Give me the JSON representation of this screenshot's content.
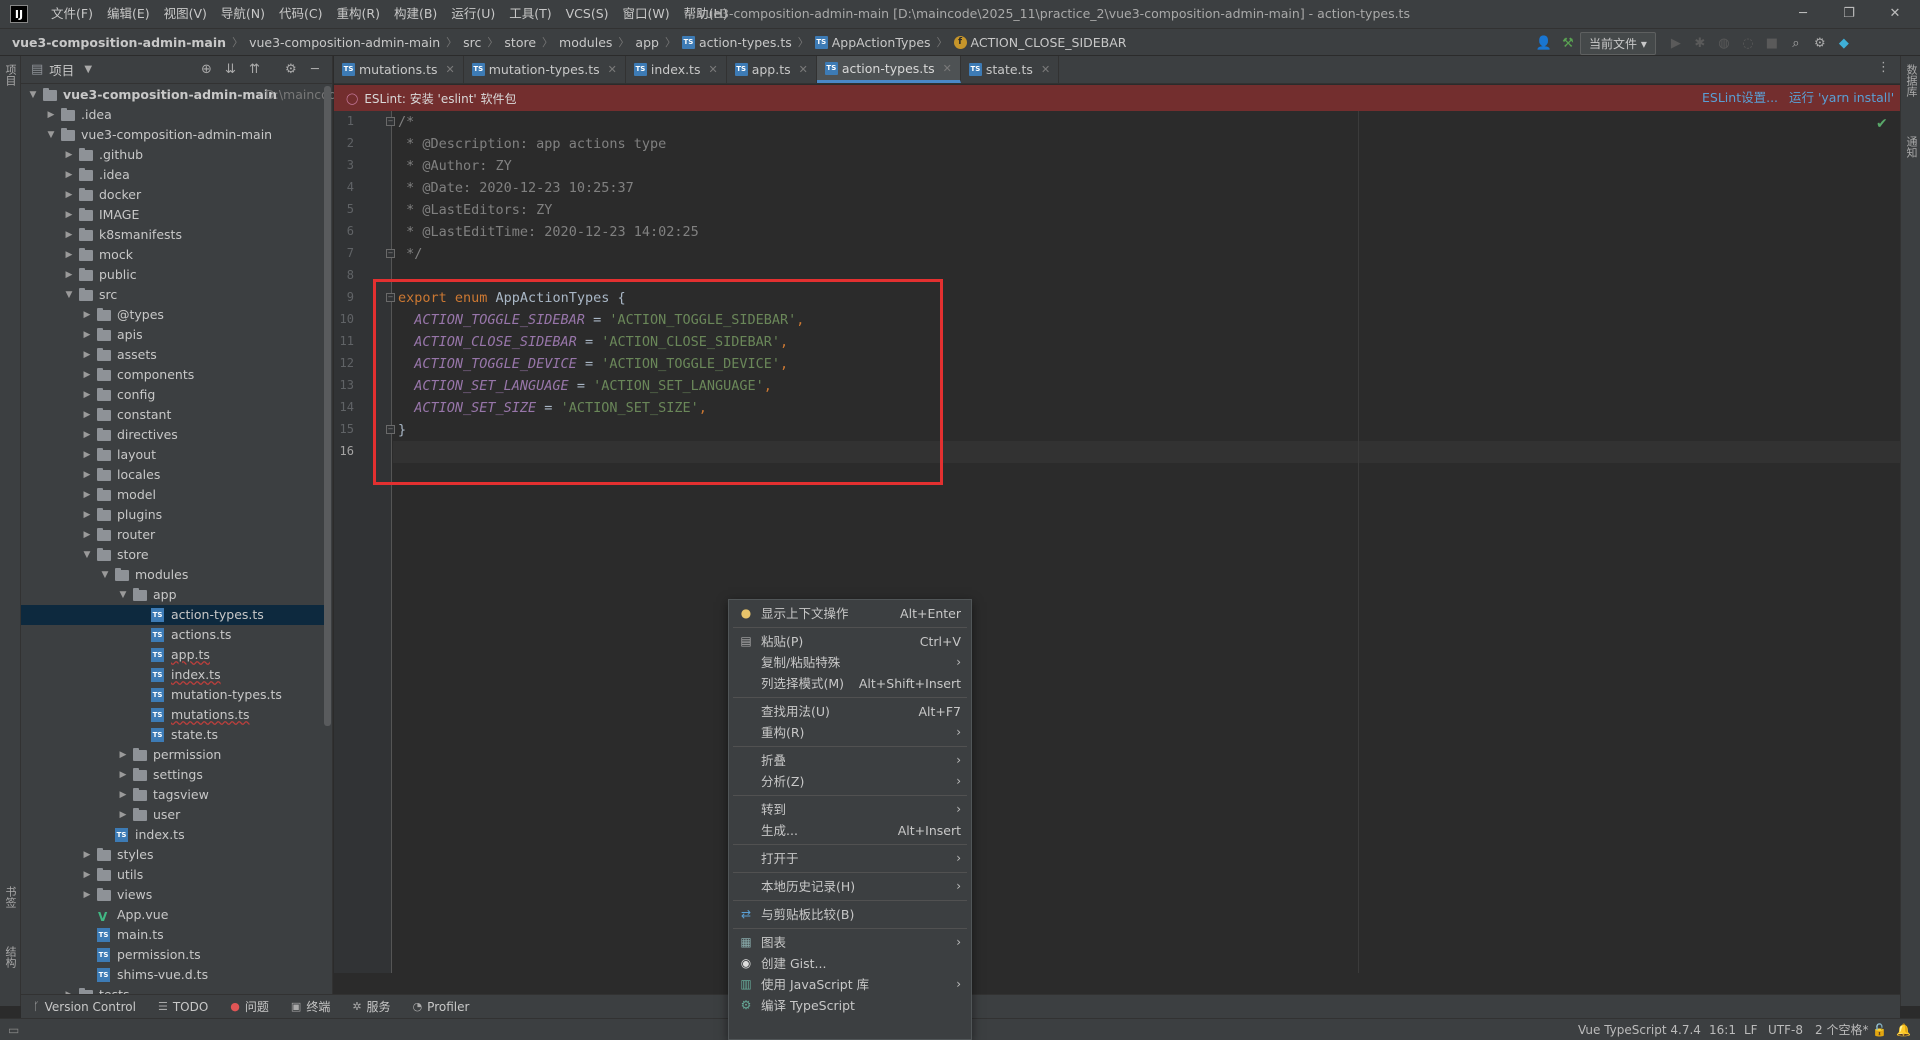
{
  "menubar": {
    "logo": "IJ",
    "items": [
      "文件(F)",
      "编辑(E)",
      "视图(V)",
      "导航(N)",
      "代码(C)",
      "重构(R)",
      "构建(B)",
      "运行(U)",
      "工具(T)",
      "VCS(S)",
      "窗口(W)",
      "帮助(H)"
    ],
    "title": "vue3-composition-admin-main [D:\\maincode\\2025_11\\practice_2\\vue3-composition-admin-main] - action-types.ts"
  },
  "breadcrumb": {
    "items": [
      "vue3-composition-admin-main",
      "vue3-composition-admin-main",
      "src",
      "store",
      "modules",
      "app",
      "action-types.ts",
      "AppActionTypes",
      "ACTION_CLOSE_SIDEBAR"
    ],
    "run_config": "当前文件"
  },
  "project_panel": {
    "title": "项目",
    "root_hint": "D:\\maincode",
    "tree": [
      {
        "label": "vue3-composition-admin-main",
        "depth": 0,
        "type": "folder",
        "open": true,
        "bold": true
      },
      {
        "label": ".idea",
        "depth": 1,
        "type": "folder",
        "open": false
      },
      {
        "label": "vue3-composition-admin-main",
        "depth": 1,
        "type": "folder",
        "open": true
      },
      {
        "label": ".github",
        "depth": 2,
        "type": "folder",
        "open": false
      },
      {
        "label": ".idea",
        "depth": 2,
        "type": "folder",
        "open": false
      },
      {
        "label": "docker",
        "depth": 2,
        "type": "folder",
        "open": false
      },
      {
        "label": "IMAGE",
        "depth": 2,
        "type": "folder",
        "open": false
      },
      {
        "label": "k8smanifests",
        "depth": 2,
        "type": "folder",
        "open": false
      },
      {
        "label": "mock",
        "depth": 2,
        "type": "folder",
        "open": false
      },
      {
        "label": "public",
        "depth": 2,
        "type": "folder",
        "open": false
      },
      {
        "label": "src",
        "depth": 2,
        "type": "folder",
        "open": true
      },
      {
        "label": "@types",
        "depth": 3,
        "type": "folder",
        "open": false
      },
      {
        "label": "apis",
        "depth": 3,
        "type": "folder",
        "open": false
      },
      {
        "label": "assets",
        "depth": 3,
        "type": "folder",
        "open": false
      },
      {
        "label": "components",
        "depth": 3,
        "type": "folder",
        "open": false
      },
      {
        "label": "config",
        "depth": 3,
        "type": "folder",
        "open": false
      },
      {
        "label": "constant",
        "depth": 3,
        "type": "folder",
        "open": false
      },
      {
        "label": "directives",
        "depth": 3,
        "type": "folder",
        "open": false
      },
      {
        "label": "layout",
        "depth": 3,
        "type": "folder",
        "open": false
      },
      {
        "label": "locales",
        "depth": 3,
        "type": "folder",
        "open": false
      },
      {
        "label": "model",
        "depth": 3,
        "type": "folder",
        "open": false
      },
      {
        "label": "plugins",
        "depth": 3,
        "type": "folder",
        "open": false
      },
      {
        "label": "router",
        "depth": 3,
        "type": "folder",
        "open": false
      },
      {
        "label": "store",
        "depth": 3,
        "type": "folder",
        "open": true
      },
      {
        "label": "modules",
        "depth": 4,
        "type": "folder",
        "open": true
      },
      {
        "label": "app",
        "depth": 5,
        "type": "folder",
        "open": true
      },
      {
        "label": "action-types.ts",
        "depth": 6,
        "type": "ts",
        "selected": true
      },
      {
        "label": "actions.ts",
        "depth": 6,
        "type": "ts"
      },
      {
        "label": "app.ts",
        "depth": 6,
        "type": "ts",
        "error": true
      },
      {
        "label": "index.ts",
        "depth": 6,
        "type": "ts",
        "error": true
      },
      {
        "label": "mutation-types.ts",
        "depth": 6,
        "type": "ts"
      },
      {
        "label": "mutations.ts",
        "depth": 6,
        "type": "ts",
        "error": true
      },
      {
        "label": "state.ts",
        "depth": 6,
        "type": "ts"
      },
      {
        "label": "permission",
        "depth": 5,
        "type": "folder",
        "open": false
      },
      {
        "label": "settings",
        "depth": 5,
        "type": "folder",
        "open": false
      },
      {
        "label": "tagsview",
        "depth": 5,
        "type": "folder",
        "open": false
      },
      {
        "label": "user",
        "depth": 5,
        "type": "folder",
        "open": false
      },
      {
        "label": "index.ts",
        "depth": 4,
        "type": "ts"
      },
      {
        "label": "styles",
        "depth": 3,
        "type": "folder",
        "open": false
      },
      {
        "label": "utils",
        "depth": 3,
        "type": "folder",
        "open": false
      },
      {
        "label": "views",
        "depth": 3,
        "type": "folder",
        "open": false
      },
      {
        "label": "App.vue",
        "depth": 3,
        "type": "vue"
      },
      {
        "label": "main.ts",
        "depth": 3,
        "type": "ts"
      },
      {
        "label": "permission.ts",
        "depth": 3,
        "type": "ts"
      },
      {
        "label": "shims-vue.d.ts",
        "depth": 3,
        "type": "ts"
      },
      {
        "label": "tests",
        "depth": 2,
        "type": "folder",
        "open": false
      }
    ]
  },
  "left_strip": {
    "top_label": "项目",
    "bottom_labels": [
      "书签",
      "结构"
    ]
  },
  "right_strip": {
    "labels": [
      "数据库",
      "通知"
    ]
  },
  "tabs": [
    {
      "label": "mutations.ts",
      "active": false
    },
    {
      "label": "mutation-types.ts",
      "active": false
    },
    {
      "label": "index.ts",
      "active": false
    },
    {
      "label": "app.ts",
      "active": false
    },
    {
      "label": "action-types.ts",
      "active": true
    },
    {
      "label": "state.ts",
      "active": false
    }
  ],
  "eslint_banner": {
    "text": "ESLint: 安装 'eslint' 软件包",
    "link_settings": "ESLint设置...",
    "link_run": "运行 'yarn install'"
  },
  "editor": {
    "current_line": 16,
    "lines": [
      [
        {
          "t": "/*",
          "c": "c-comment"
        }
      ],
      [
        {
          "t": " * ",
          "c": "c-comment"
        },
        {
          "t": "@Description: app actions type",
          "c": "c-comment"
        }
      ],
      [
        {
          "t": " * ",
          "c": "c-comment"
        },
        {
          "t": "@Author: ZY",
          "c": "c-comment"
        }
      ],
      [
        {
          "t": " * ",
          "c": "c-comment"
        },
        {
          "t": "@Date: 2020-12-23 10:25:37",
          "c": "c-comment"
        }
      ],
      [
        {
          "t": " * ",
          "c": "c-comment"
        },
        {
          "t": "@LastEditors: ZY",
          "c": "c-comment"
        }
      ],
      [
        {
          "t": " * ",
          "c": "c-comment"
        },
        {
          "t": "@LastEditTime: 2020-12-23 14:02:25",
          "c": "c-comment"
        }
      ],
      [
        {
          "t": " */",
          "c": "c-comment"
        }
      ],
      [],
      [
        {
          "t": "export ",
          "c": "c-kw"
        },
        {
          "t": "enum ",
          "c": "c-kw"
        },
        {
          "t": "AppActionTypes {",
          "c": "c-ident"
        }
      ],
      [
        {
          "t": "  ACTION_TOGGLE_SIDEBAR",
          "c": "c-member"
        },
        {
          "t": " = ",
          "c": "c-op"
        },
        {
          "t": "'ACTION_TOGGLE_SIDEBAR'",
          "c": "c-str"
        },
        {
          "t": ",",
          "c": "c-punct"
        }
      ],
      [
        {
          "t": "  ACTION_CLOSE_SIDEBAR",
          "c": "c-member"
        },
        {
          "t": " = ",
          "c": "c-op"
        },
        {
          "t": "'ACTION_CLOSE_SIDEBAR'",
          "c": "c-str"
        },
        {
          "t": ",",
          "c": "c-punct"
        }
      ],
      [
        {
          "t": "  ACTION_TOGGLE_DEVICE",
          "c": "c-member"
        },
        {
          "t": " = ",
          "c": "c-op"
        },
        {
          "t": "'ACTION_TOGGLE_DEVICE'",
          "c": "c-str"
        },
        {
          "t": ",",
          "c": "c-punct"
        }
      ],
      [
        {
          "t": "  ACTION_SET_LANGUAGE",
          "c": "c-member"
        },
        {
          "t": " = ",
          "c": "c-op"
        },
        {
          "t": "'ACTION_SET_LANGUAGE'",
          "c": "c-str"
        },
        {
          "t": ",",
          "c": "c-punct"
        }
      ],
      [
        {
          "t": "  ACTION_SET_SIZE",
          "c": "c-member"
        },
        {
          "t": " = ",
          "c": "c-op"
        },
        {
          "t": "'ACTION_SET_SIZE'",
          "c": "c-str"
        },
        {
          "t": ",",
          "c": "c-punct"
        }
      ],
      [
        {
          "t": "}",
          "c": "c-ident"
        }
      ],
      []
    ]
  },
  "context_menu": {
    "items": [
      {
        "label": "显示上下文操作",
        "shortcut": "Alt+Enter",
        "icon": "bulb-icon"
      },
      {
        "sep": true
      },
      {
        "label": "粘贴(P)",
        "shortcut": "Ctrl+V",
        "icon": "paste-icon"
      },
      {
        "label": "复制/粘贴特殊",
        "submenu": true
      },
      {
        "label": "列选择模式(M)",
        "shortcut": "Alt+Shift+Insert"
      },
      {
        "sep": true
      },
      {
        "label": "查找用法(U)",
        "shortcut": "Alt+F7"
      },
      {
        "label": "重构(R)",
        "submenu": true
      },
      {
        "sep": true
      },
      {
        "label": "折叠",
        "submenu": true
      },
      {
        "label": "分析(Z)",
        "submenu": true
      },
      {
        "sep": true
      },
      {
        "label": "转到",
        "submenu": true
      },
      {
        "label": "生成...",
        "shortcut": "Alt+Insert"
      },
      {
        "sep": true
      },
      {
        "label": "打开于",
        "submenu": true
      },
      {
        "sep": true
      },
      {
        "label": "本地历史记录(H)",
        "submenu": true
      },
      {
        "sep": true
      },
      {
        "label": "与剪贴板比较(B)",
        "icon": "compare-icon"
      },
      {
        "sep": true
      },
      {
        "label": "图表",
        "submenu": true,
        "icon": "diagram-icon"
      },
      {
        "label": "创建 Gist...",
        "icon": "github-icon"
      },
      {
        "label": "使用 JavaScript 库",
        "submenu": true,
        "icon": "library-icon"
      },
      {
        "label": "编译 TypeScript",
        "icon": "compile-icon"
      }
    ]
  },
  "bottom_tools": [
    {
      "label": "Version Control",
      "icon": "branch-icon",
      "glyph": "ᚴ"
    },
    {
      "label": "TODO",
      "icon": "todo-icon",
      "glyph": "☰"
    },
    {
      "label": "问题",
      "icon": "problems-icon",
      "glyph": "●"
    },
    {
      "label": "终端",
      "icon": "terminal-icon",
      "glyph": "▣"
    },
    {
      "label": "服务",
      "icon": "services-icon",
      "glyph": "✲"
    },
    {
      "label": "Profiler",
      "icon": "profiler-icon",
      "glyph": "◔"
    }
  ],
  "statusbar": {
    "language": "Vue TypeScript 4.7.4",
    "position": "16:1",
    "line_sep": "LF",
    "encoding": "UTF-8",
    "indent": "2 个空格*"
  }
}
